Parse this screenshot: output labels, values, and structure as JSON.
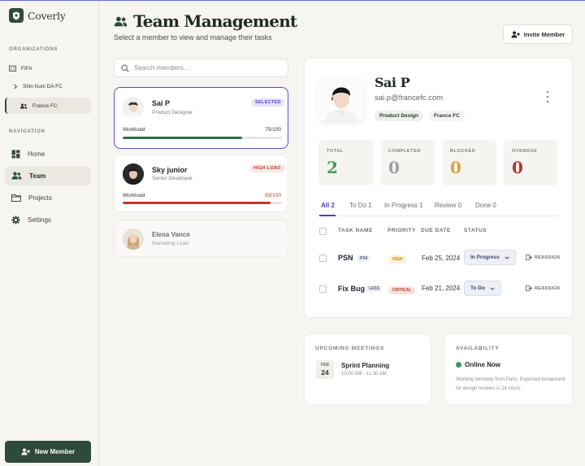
{
  "brand": {
    "name": "Coverly"
  },
  "sidebar": {
    "organizations_label": "ORGANIZATIONS",
    "orgs": [
      {
        "label": "FIFA"
      },
      {
        "label": "Shin Kuni DA FC"
      },
      {
        "label": "France FC"
      }
    ],
    "navigation_label": "NAVIGATION",
    "nav": [
      {
        "label": "Home"
      },
      {
        "label": "Team"
      },
      {
        "label": "Projects"
      },
      {
        "label": "Settings"
      }
    ],
    "new_member_label": "New Member"
  },
  "header": {
    "title": "Team Management",
    "subtitle": "Select a member to view and manage their tasks",
    "invite_label": "Invite Member"
  },
  "search": {
    "placeholder": "Search members..."
  },
  "members": [
    {
      "name": "Sai P",
      "role": "Product Designer",
      "badge": "SELECTED",
      "workload_label": "Workload",
      "workload_text": "75/100",
      "workload": 0.75
    },
    {
      "name": "Sky junior",
      "role": "Senior Developer",
      "badge": "HIGH LOAD",
      "workload_label": "Workload",
      "workload_text": "93/100",
      "workload": 0.93
    },
    {
      "name": "Elena Vance",
      "role": "Marketing Lead"
    }
  ],
  "detail": {
    "name": "Sai P",
    "email": "sai.p@francefc.com",
    "tags": [
      "Product Design",
      "France FC"
    ],
    "stats": [
      {
        "label": "TOTAL",
        "value": "2",
        "color": "#3f9c5a"
      },
      {
        "label": "COMPLETED",
        "value": "0",
        "color": "#9aa0a8"
      },
      {
        "label": "BLOCKED",
        "value": "0",
        "color": "#e0a33a"
      },
      {
        "label": "OVERDUE",
        "value": "0",
        "color": "#b53a2e"
      }
    ],
    "tabs": [
      "All 2",
      "To Do 1",
      "In Progress 1",
      "Review 0",
      "Done 0"
    ],
    "columns": [
      "TASK NAME",
      "PRIORITY",
      "DUE DATE",
      "STATUS"
    ],
    "tasks": [
      {
        "name": "PSN",
        "code": "PS4",
        "priority": "HIGH",
        "due": "Feb 25, 2024",
        "status": "In Progress",
        "action": "REASSIGN"
      },
      {
        "name": "Fix Bug",
        "code": "LESS",
        "priority": "CRITICAL",
        "due": "Feb 21, 2024",
        "status": "To Do",
        "action": "REASSIGN"
      }
    ]
  },
  "meetings": {
    "title": "UPCOMING MEETINGS",
    "items": [
      {
        "month": "FEB",
        "day": "24",
        "name": "Sprint Planning",
        "time": "10:00 AM - 11:30 AM"
      }
    ]
  },
  "availability": {
    "title": "AVAILABILITY",
    "status": "Online Now",
    "note": "Working remotely from Paris. Expected turnaround for design reviews is 24 hours."
  },
  "colors": {
    "primary": "#2f4a3a",
    "accent": "#4a3fc0",
    "danger": "#c0392b",
    "success": "#3f9c5a"
  }
}
